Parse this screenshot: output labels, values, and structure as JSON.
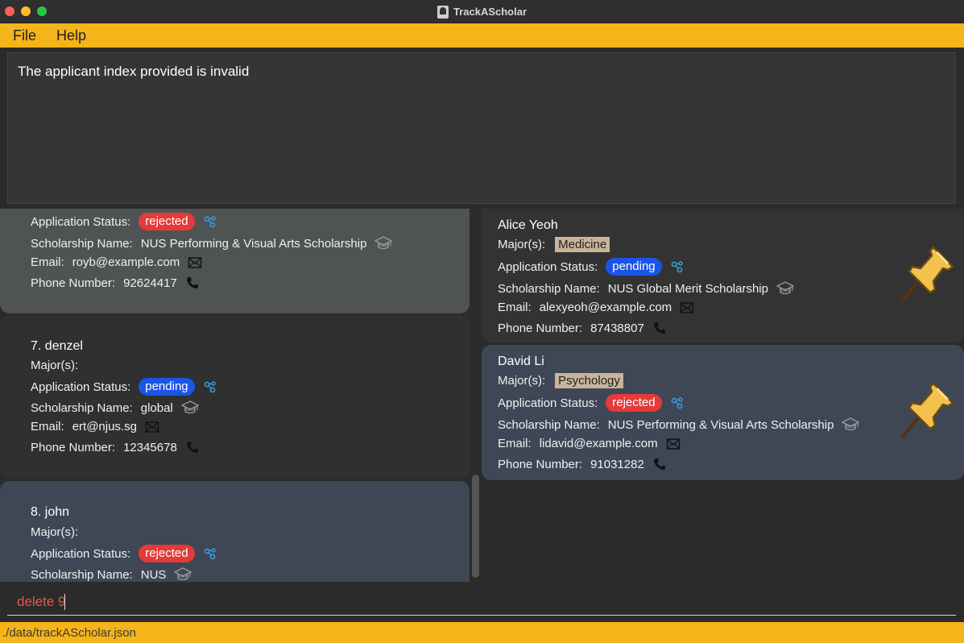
{
  "window": {
    "title": "TrackAScholar"
  },
  "menu": {
    "file": "File",
    "help": "Help"
  },
  "result": {
    "message": "The applicant index provided is invalid"
  },
  "labels": {
    "major": "Major(s):",
    "status": "Application Status:",
    "scholarship": "Scholarship Name:",
    "email": "Email:",
    "phone": "Phone Number:"
  },
  "left_list": [
    {
      "status": "rejected",
      "scholarship": "NUS Performing & Visual Arts Scholarship",
      "email": "royb@example.com",
      "phone": "92624417"
    },
    {
      "index_name": "7.  denzel",
      "status": "pending",
      "scholarship": "global",
      "email": "ert@njus.sg",
      "phone": "12345678"
    },
    {
      "index_name": "8.  john",
      "status": "rejected",
      "scholarship": "NUS"
    }
  ],
  "pinned_list": [
    {
      "name": "Alice Yeoh",
      "major": "Medicine",
      "status": "pending",
      "scholarship": "NUS Global Merit Scholarship",
      "email": "alexyeoh@example.com",
      "phone": "87438807"
    },
    {
      "name": "David Li",
      "major": "Psychology",
      "status": "rejected",
      "scholarship": "NUS Performing & Visual Arts Scholarship",
      "email": "lidavid@example.com",
      "phone": "91031282"
    }
  ],
  "command": {
    "value": "delete 9"
  },
  "status_bar": {
    "path": "./data/trackAScholar.json"
  },
  "colors": {
    "accent": "#f4b41a",
    "rejected": "#e43a3a",
    "pending": "#1a55e6",
    "major_tag": "#c8b49a",
    "selected_card": "#3f4756",
    "command_text": "#e05a4a"
  },
  "icons": [
    "status-graph-icon",
    "graduation-cap-icon",
    "envelope-icon",
    "phone-icon",
    "pushpin-icon"
  ]
}
